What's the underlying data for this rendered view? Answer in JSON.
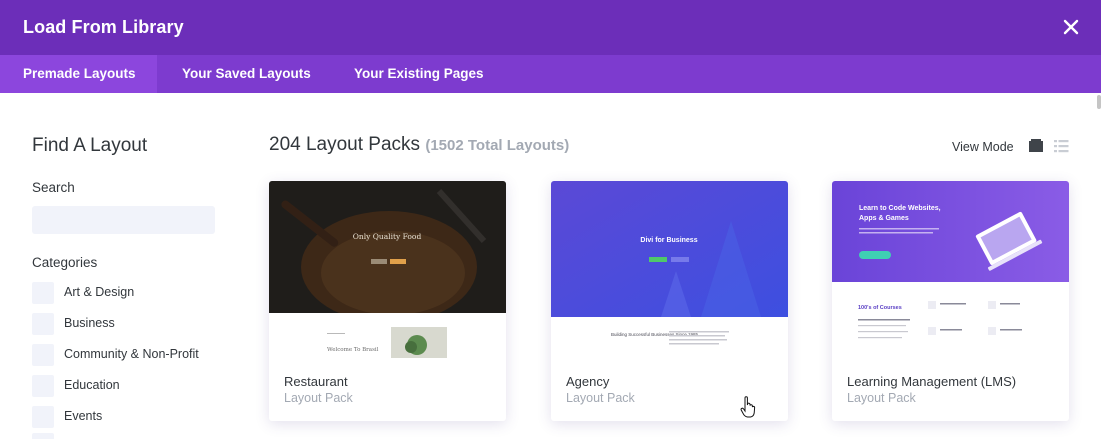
{
  "window": {
    "title": "Load From Library",
    "close_icon": "close-icon"
  },
  "tabs": [
    {
      "label": "Premade Layouts",
      "active": true
    },
    {
      "label": "Your Saved Layouts",
      "active": false
    },
    {
      "label": "Your Existing Pages",
      "active": false
    }
  ],
  "sidebar": {
    "heading": "Find A Layout",
    "search_label": "Search",
    "search_value": "",
    "categories_label": "Categories",
    "categories": [
      {
        "label": "Art & Design"
      },
      {
        "label": "Business"
      },
      {
        "label": "Community & Non-Profit"
      },
      {
        "label": "Education"
      },
      {
        "label": "Events"
      }
    ]
  },
  "main": {
    "heading": "204 Layout Packs",
    "count": "(1502 Total Layouts)",
    "view_mode_label": "View Mode",
    "view_mode_icons": [
      "grid-view-icon",
      "list-view-icon"
    ]
  },
  "cards": [
    {
      "name": "Restaurant",
      "sub": "Layout Pack",
      "preview": {
        "hero_text": "Only Quality Food",
        "welcome_text": "Welcome To Brasil"
      }
    },
    {
      "name": "Agency",
      "sub": "Layout Pack",
      "preview": {
        "hero_text": "Divi for Business",
        "tagline": "Building Successful Businesses Since 1985"
      }
    },
    {
      "name": "Learning Management (LMS)",
      "sub": "Layout Pack",
      "preview": {
        "hero_text_1": "Learn to Code Websites,",
        "hero_text_2": "Apps & Games",
        "courses_text": "100's of Courses"
      }
    }
  ],
  "colors": {
    "header_bg": "#6c2eb9",
    "tabbar_bg": "#7d3bcf",
    "active_tab_bg": "#8c46dd",
    "muted_text": "#a3a9b3",
    "input_bg": "#f1f3fa"
  }
}
